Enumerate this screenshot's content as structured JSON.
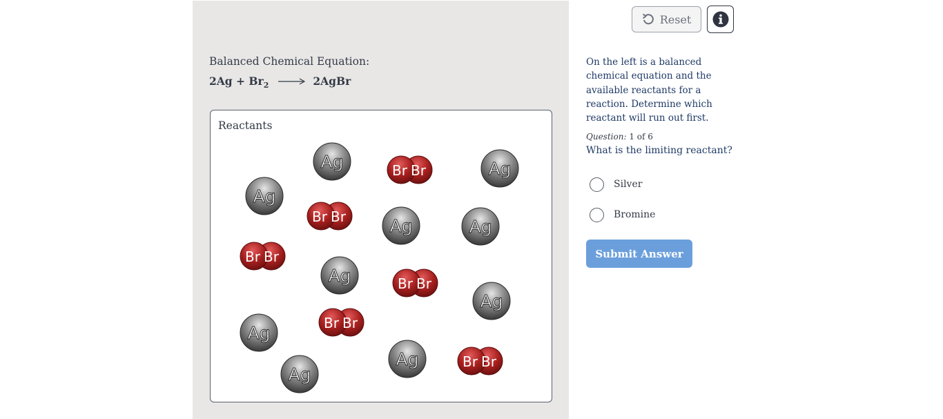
{
  "equation": {
    "label": "Balanced Chemical Equation:",
    "reactant_1": "2Ag + Br",
    "reactant_1_subscript": "2",
    "product": "2AgBr"
  },
  "reactants_box": {
    "title": "Reactants",
    "silver_symbol": "Ag",
    "bromine_symbol": "Br",
    "silver_count": 10,
    "bromine_molecule_count": 6
  },
  "toolbar": {
    "reset_label": "Reset"
  },
  "panel": {
    "instructions": "On the left is a balanced chemical equation and the available reactants for a reaction. Determine which reactant will run out first.",
    "question_count_prefix": "Question:",
    "question_count_value": "1 of 6",
    "question": "What is the limiting reactant?",
    "options": [
      {
        "label": "Silver",
        "selected": false
      },
      {
        "label": "Bromine",
        "selected": false
      }
    ],
    "submit_label": "Submit Answer"
  },
  "colors": {
    "panel_bg": "#e8e7e6",
    "silver_atom": "#5a5a5a",
    "bromine_atom": "#a8201f",
    "submit_bg": "#6b9fdc",
    "instruction_text": "#1f3a66"
  }
}
